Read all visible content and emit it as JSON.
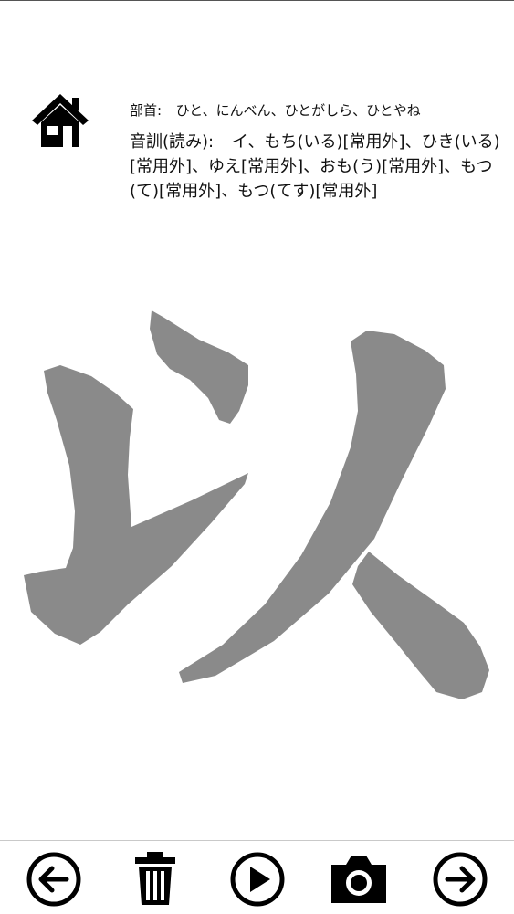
{
  "info": {
    "radical_label": "部首:",
    "radical_value": "ひと、にんべん、ひとがしら、ひとやね",
    "reading_label": "音訓(読み):",
    "reading_value": "イ、もち(いる)[常用外]、ひき(いる)[常用外]、ゆえ[常用外]、おも(う)[常用外]、もつ(て)[常用外]、もつ(てす)[常用外]"
  },
  "kanji": {
    "character": "以",
    "fill_color": "#8a8a8a"
  },
  "icons": {
    "home": "home-icon",
    "back": "arrow-left-circle-icon",
    "delete": "trash-icon",
    "play": "play-circle-icon",
    "camera": "camera-icon",
    "next": "arrow-right-circle-icon"
  }
}
